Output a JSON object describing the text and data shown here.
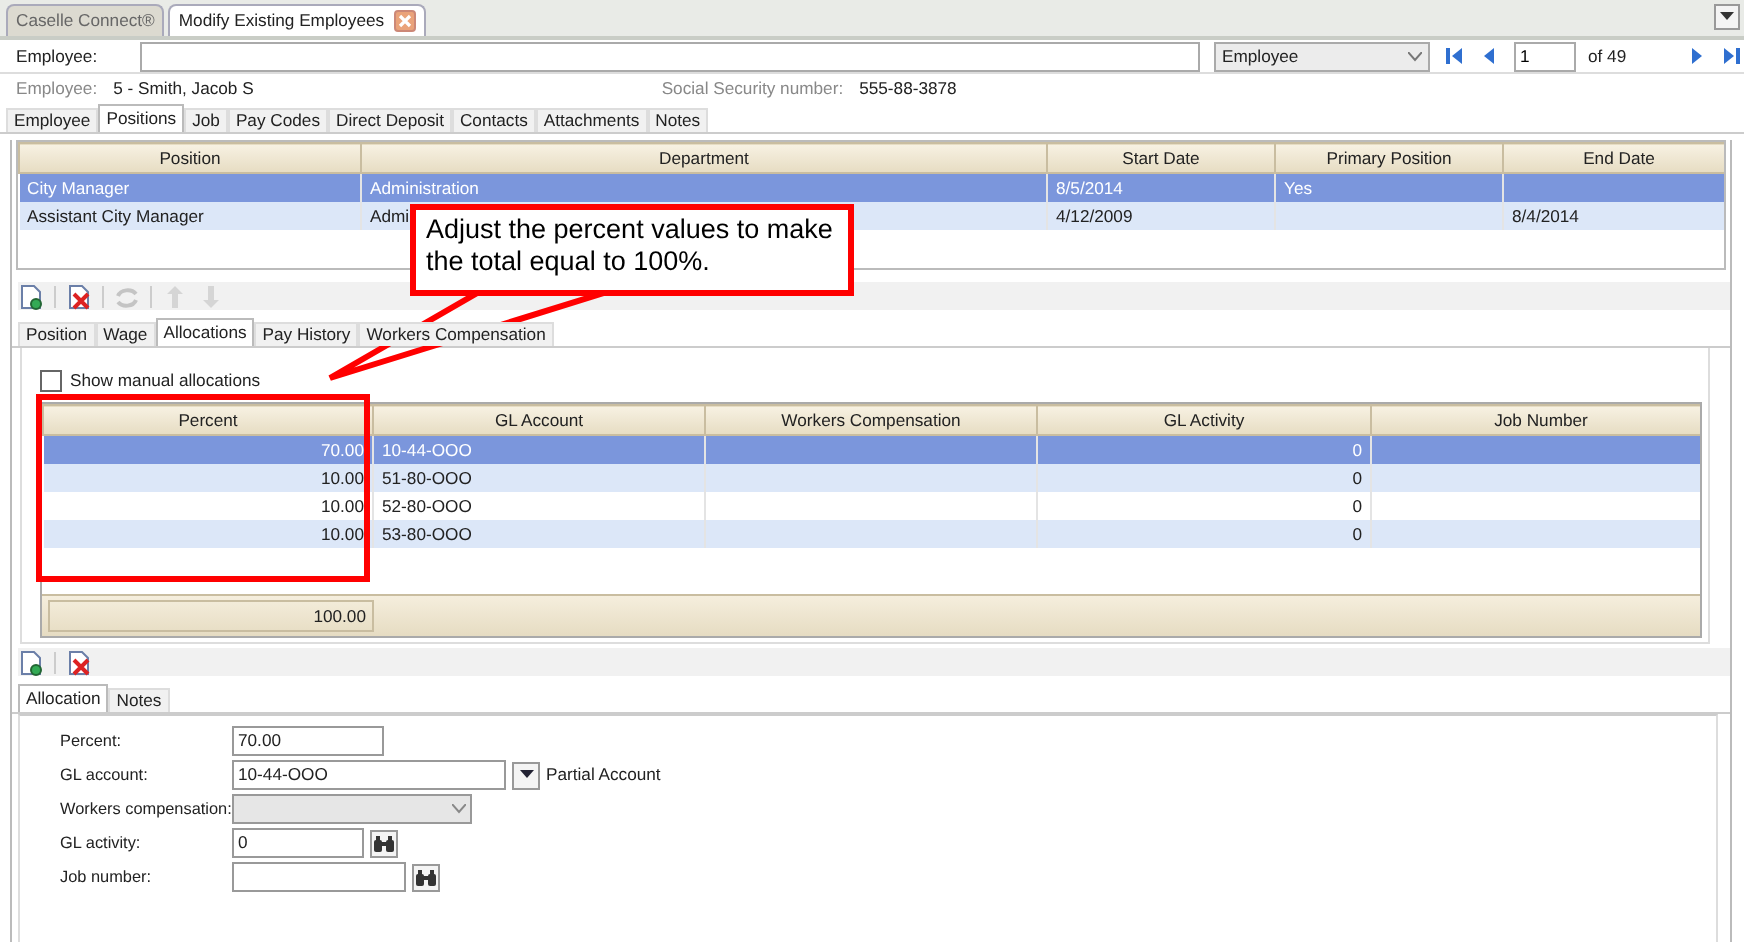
{
  "document_tabs": [
    {
      "label": "Caselle Connect®",
      "selected": false,
      "closable": false
    },
    {
      "label": "Modify Existing Employees",
      "selected": true,
      "closable": true
    }
  ],
  "search": {
    "label": "Employee:",
    "search_type": "Employee",
    "page": "1",
    "page_total": "of 49"
  },
  "employee_info": {
    "label": "Employee:",
    "value": "5 - Smith, Jacob S",
    "ssn_label": "Social Security number:",
    "ssn": "555-88-3878"
  },
  "tabs": [
    {
      "label": "Employee",
      "selected": false
    },
    {
      "label": "Positions",
      "selected": true
    },
    {
      "label": "Job",
      "selected": false
    },
    {
      "label": "Pay Codes",
      "selected": false
    },
    {
      "label": "Direct Deposit",
      "selected": false
    },
    {
      "label": "Contacts",
      "selected": false
    },
    {
      "label": "Attachments",
      "selected": false
    },
    {
      "label": "Notes",
      "selected": false
    }
  ],
  "positions_table": {
    "columns": [
      "Position",
      "Department",
      "Start Date",
      "Primary Position",
      "End Date"
    ],
    "rows": [
      {
        "selected": true,
        "cells": [
          "City Manager",
          "Administration",
          "8/5/2014",
          "Yes",
          ""
        ]
      },
      {
        "selected": false,
        "cells": [
          "Assistant City Manager",
          "Admi",
          "4/12/2009",
          "",
          "8/4/2014"
        ]
      }
    ]
  },
  "position_toolbar": [
    {
      "kind": "new",
      "disabled": false
    },
    {
      "kind": "delete",
      "disabled": false
    },
    {
      "kind": "refresh",
      "disabled": true
    },
    {
      "kind": "up",
      "disabled": true
    },
    {
      "kind": "down",
      "disabled": true
    }
  ],
  "position_tabs": [
    {
      "label": "Position",
      "selected": false
    },
    {
      "label": "Wage",
      "selected": false
    },
    {
      "label": "Allocations",
      "selected": true
    },
    {
      "label": "Pay History",
      "selected": false
    },
    {
      "label": "Workers Compensation",
      "selected": false
    }
  ],
  "show_manual_allocations": {
    "label": "Show manual allocations",
    "checked": false
  },
  "allocations_table": {
    "columns": [
      "Percent",
      "GL Account",
      "Workers Compensation",
      "GL Activity",
      "Job Number"
    ],
    "rows": [
      {
        "selected": true,
        "cells": [
          "70.00",
          "10-44-OOO",
          "",
          "0",
          ""
        ]
      },
      {
        "selected": false,
        "cells": [
          "10.00",
          "51-80-OOO",
          "",
          "0",
          ""
        ]
      },
      {
        "selected": false,
        "cells": [
          "10.00",
          "52-80-OOO",
          "",
          "0",
          ""
        ]
      },
      {
        "selected": false,
        "cells": [
          "10.00",
          "53-80-OOO",
          "",
          "0",
          ""
        ]
      }
    ],
    "total": "100.00"
  },
  "allocation_toolbar": [
    {
      "kind": "new",
      "disabled": false
    },
    {
      "kind": "delete",
      "disabled": false
    }
  ],
  "detail_tabs": [
    {
      "label": "Allocation",
      "selected": true
    },
    {
      "label": "Notes",
      "selected": false
    }
  ],
  "form": [
    {
      "kind": "text",
      "label": "Percent:",
      "value": "70.00"
    },
    {
      "kind": "account",
      "label": "GL account:",
      "value": "10-44-OOO",
      "note": "Partial Account"
    },
    {
      "kind": "select",
      "label": "Workers compensation:",
      "disabled": true
    },
    {
      "kind": "lookup",
      "label": "GL activity:",
      "value": "0"
    },
    {
      "kind": "lookup",
      "label": "Job number:"
    }
  ],
  "callout": {
    "text": "Adjust the percent values to make the total equal to 100%."
  }
}
